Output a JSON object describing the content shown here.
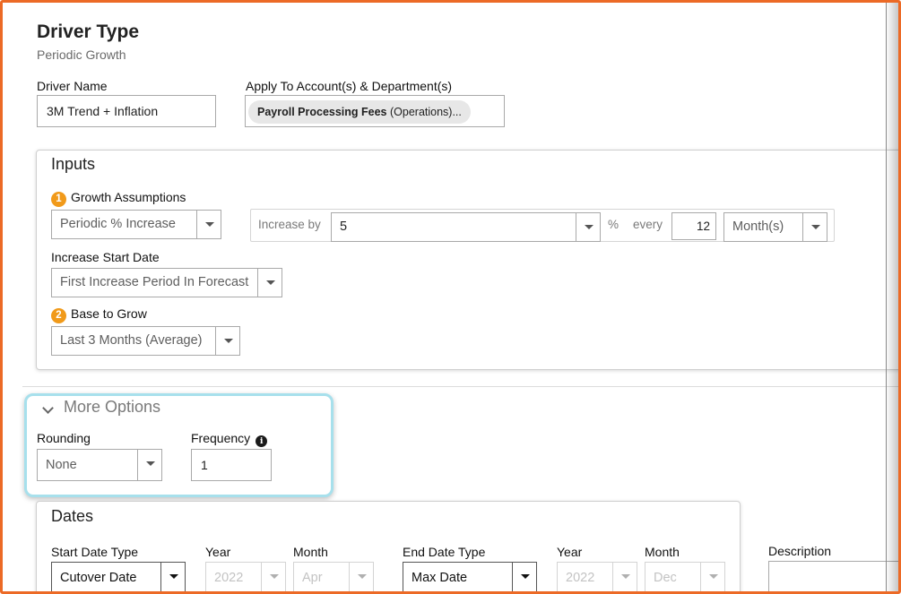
{
  "header": {
    "title": "Driver Type",
    "subtitle": "Periodic Growth"
  },
  "driver_name": {
    "label": "Driver Name",
    "value": "3M Trend + Inflation"
  },
  "apply_to": {
    "label": "Apply To Account(s) & Department(s)",
    "chip_account": "Payroll Processing Fees",
    "chip_department": " (Operations)..."
  },
  "inputs": {
    "title": "Inputs",
    "growth": {
      "step": "1",
      "label": "Growth Assumptions",
      "method": "Periodic % Increase",
      "increase_by_label": "Increase by",
      "increase_value": "5",
      "percent_symbol": "%",
      "every_label": "every",
      "every_value": "12",
      "period_unit": "Month(s)"
    },
    "increase_start": {
      "label": "Increase Start Date",
      "value": "First Increase Period In Forecast"
    },
    "base": {
      "step": "2",
      "label": "Base to Grow",
      "value": "Last 3 Months (Average)"
    }
  },
  "more_options": {
    "title": "More Options",
    "rounding_label": "Rounding",
    "rounding_value": "None",
    "frequency_label": "Frequency",
    "frequency_value": "1"
  },
  "dates": {
    "title": "Dates",
    "start_date_type_label": "Start Date Type",
    "start_date_type_value": "Cutover Date",
    "start_year_label": "Year",
    "start_year_value": "2022",
    "start_month_label": "Month",
    "start_month_value": "Apr",
    "end_date_type_label": "End Date Type",
    "end_date_type_value": "Max Date",
    "end_year_label": "Year",
    "end_year_value": "2022",
    "end_month_label": "Month",
    "end_month_value": "Dec"
  },
  "description": {
    "label": "Description"
  },
  "colors": {
    "frame_border": "#ec6a26",
    "step_badge": "#f19a1a",
    "highlight": "#a7e0ec"
  }
}
